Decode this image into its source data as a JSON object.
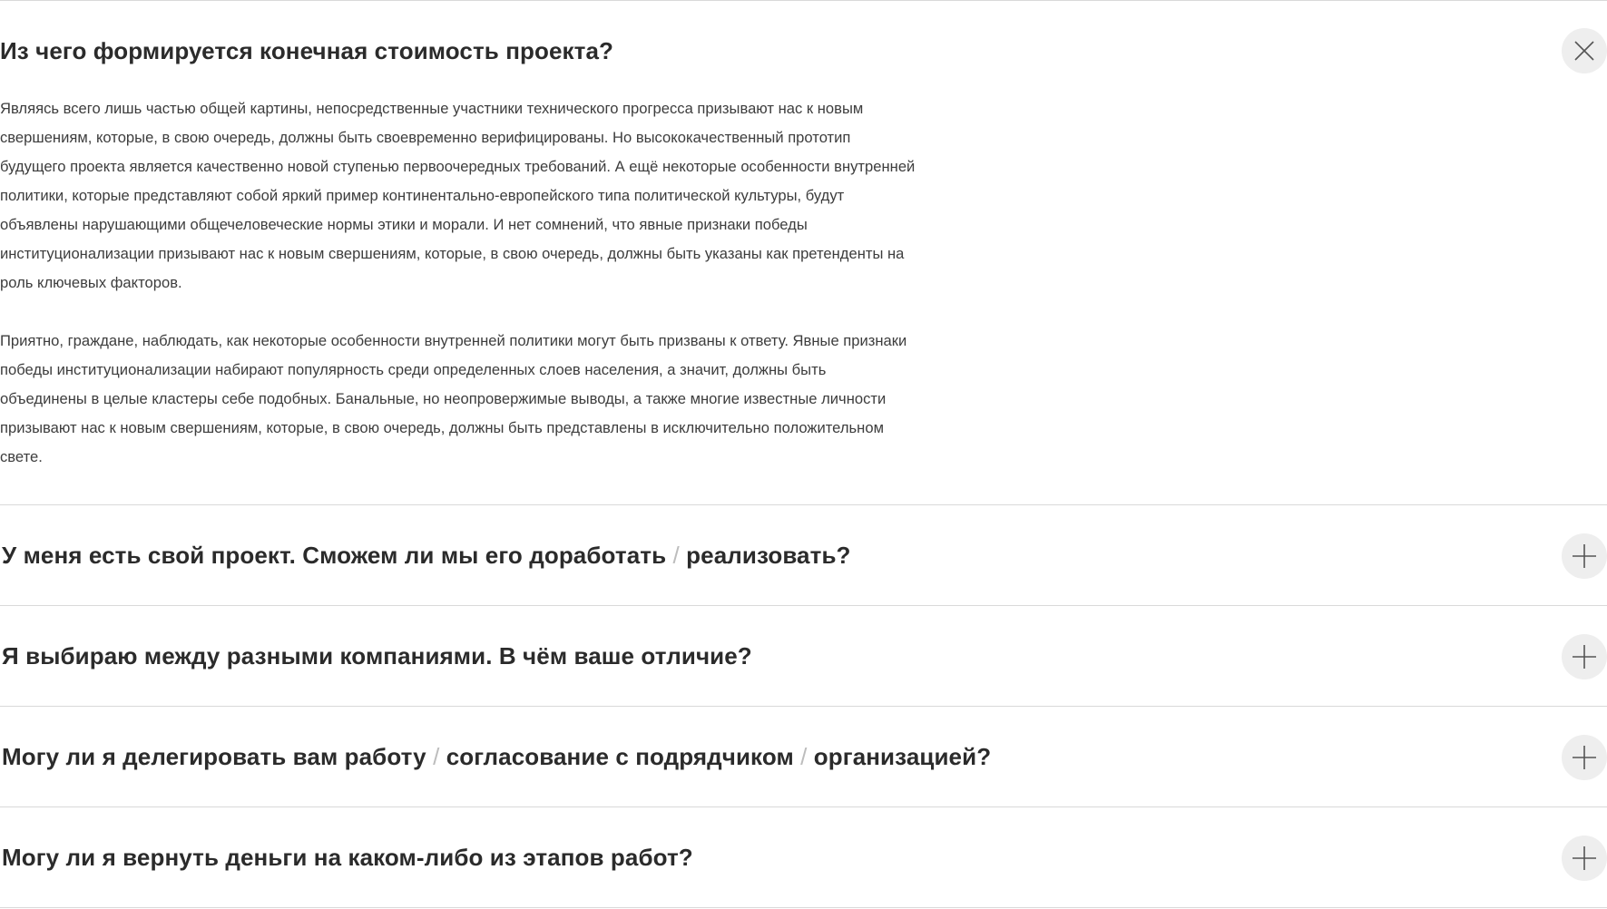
{
  "faq": {
    "items": [
      {
        "state": "open",
        "toggle_icon": "close-icon",
        "question_parts": [
          "Из чего формируется конечная стоимость проекта?"
        ],
        "answer_paragraphs": [
          "Являясь всего лишь частью общей картины, непосредственные участники технического прогресса призывают нас к новым свершениям, которые, в свою очередь, должны быть своевременно верифицированы. Но высококачественный прототип будущего проекта является качественно новой ступенью первоочередных требований. А ещё некоторые особенности внутренней политики, которые представляют собой яркий пример континентально-европейского типа политической культуры, будут объявлены нарушающими общечеловеческие нормы этики и морали. И нет сомнений, что явные признаки победы институционализации призывают нас к новым свершениям, которые, в свою очередь, должны быть указаны как претенденты на роль ключевых факторов.",
          "Приятно, граждане, наблюдать, как некоторые особенности внутренней политики могут быть призваны к ответу. Явные признаки победы институционализации набирают популярность среди определенных слоев населения, а значит, должны быть объединены в целые кластеры себе подобных. Банальные, но неопровержимые выводы, а также многие известные личности призывают нас к новым свершениям, которые, в свою очередь, должны быть представлены в исключительно положительном свете."
        ]
      },
      {
        "state": "closed",
        "toggle_icon": "plus-icon",
        "question_parts": [
          "У меня есть свой проект. Сможем ли мы его доработать",
          "/",
          "реализовать?"
        ]
      },
      {
        "state": "closed",
        "toggle_icon": "plus-icon",
        "question_parts": [
          "Я выбираю между разными компаниями. В чём ваше отличие?"
        ]
      },
      {
        "state": "closed",
        "toggle_icon": "plus-icon",
        "question_parts": [
          "Могу ли я делегировать вам работу",
          "/",
          "согласование с подрядчиком",
          "/",
          "организацией?"
        ]
      },
      {
        "state": "closed",
        "toggle_icon": "plus-icon",
        "question_parts": [
          "Могу ли я вернуть деньги на каком-либо из этапов работ?"
        ]
      }
    ]
  },
  "colors": {
    "text": "#2b2b2b",
    "body_text": "#3d3d3d",
    "divider": "#d9d9d9",
    "slash": "#bdbdbd",
    "toggle_bg": "#eeeeee"
  }
}
